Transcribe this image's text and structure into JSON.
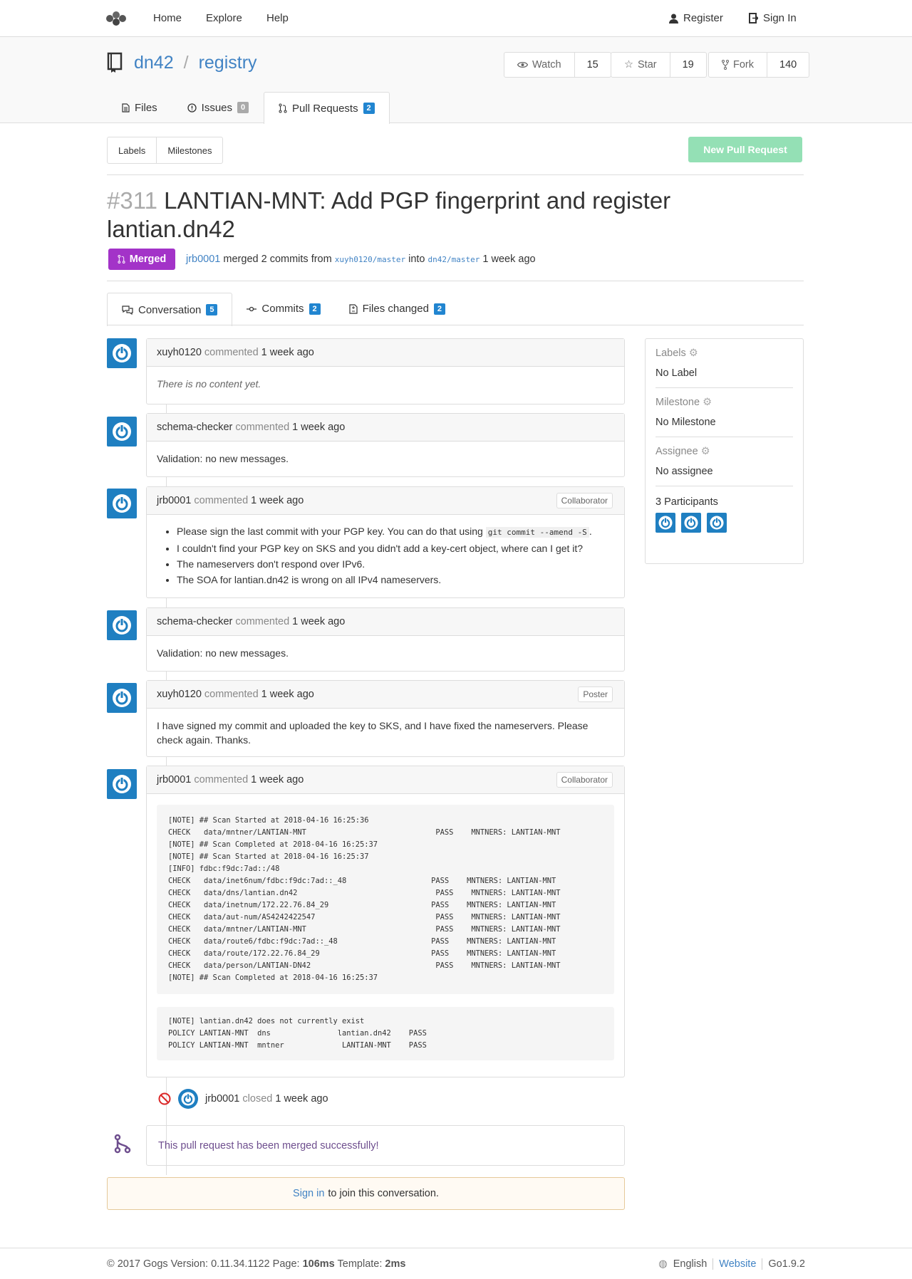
{
  "nav": {
    "home": "Home",
    "explore": "Explore",
    "help": "Help",
    "register": "Register",
    "sign_in": "Sign In"
  },
  "repo": {
    "owner": "dn42",
    "separator": "/",
    "name": "registry"
  },
  "actions": [
    {
      "label": "Watch",
      "count": "15",
      "icon": "eye-icon"
    },
    {
      "label": "Star",
      "count": "19",
      "icon": "star-icon"
    },
    {
      "label": "Fork",
      "count": "140",
      "icon": "fork-icon"
    }
  ],
  "repo_tabs": [
    {
      "label": "Files",
      "icon": "file-text-icon"
    },
    {
      "label": "Issues",
      "count": "0",
      "icon": "issue-icon"
    },
    {
      "label": "Pull Requests",
      "count": "2",
      "icon": "pull-request-icon"
    }
  ],
  "subnav": {
    "labels": "Labels",
    "milestones": "Milestones",
    "new_pr": "New Pull Request"
  },
  "pr": {
    "number": "#311",
    "title": "LANTIAN-MNT: Add PGP fingerprint and register lantian.dn42",
    "status": "Merged",
    "merger": "jrb0001",
    "merged_text": "merged 2 commits from",
    "head_branch": "xuyh0120/master",
    "into": "into",
    "base_branch": "dn42/master",
    "time": "1 week ago"
  },
  "conv_tabs": [
    {
      "label": "Conversation",
      "count": "5",
      "icon": "comments-icon"
    },
    {
      "label": "Commits",
      "count": "2",
      "icon": "commit-icon"
    },
    {
      "label": "Files changed",
      "count": "2",
      "icon": "file-diff-icon"
    }
  ],
  "comments": [
    {
      "user": "xuyh0120",
      "action": "commented",
      "time": "1 week ago",
      "role": "",
      "body": "There is no content yet."
    },
    {
      "user": "schema-checker",
      "action": "commented",
      "time": "1 week ago",
      "role": "",
      "body": "Validation: no new messages."
    },
    {
      "user": "jrb0001",
      "action": "commented",
      "time": "1 week ago",
      "role": "Collaborator",
      "items": [
        {
          "pre": "Please sign the last commit with your PGP key. You can do that using",
          "code": "git commit --amend -S",
          "post": "."
        },
        {
          "pre": "I couldn't find your PGP key on SKS and you didn't add a key-cert object, where can I get it?"
        },
        {
          "pre": "The nameservers don't respond over IPv6."
        },
        {
          "pre": "The SOA for lantian.dn42 is wrong on all IPv4 nameservers."
        }
      ]
    },
    {
      "user": "schema-checker",
      "action": "commented",
      "time": "1 week ago",
      "role": "",
      "body": "Validation: no new messages."
    },
    {
      "user": "xuyh0120",
      "action": "commented",
      "time": "1 week ago",
      "role": "Poster",
      "body": "I have signed my commit and uploaded the key to SKS, and I have fixed the nameservers. Please check again. Thanks."
    },
    {
      "user": "jrb0001",
      "action": "commented",
      "time": "1 week ago",
      "role": "Collaborator",
      "log1": "[NOTE] ## Scan Started at 2018-04-16 16:25:36\nCHECK   data/mntner/LANTIAN-MNT                             PASS    MNTNERS: LANTIAN-MNT\n[NOTE] ## Scan Completed at 2018-04-16 16:25:37\n[NOTE] ## Scan Started at 2018-04-16 16:25:37\n[INFO] fdbc:f9dc:7ad::/48\nCHECK   data/inet6num/fdbc:f9dc:7ad::_48                   PASS    MNTNERS: LANTIAN-MNT\nCHECK   data/dns/lantian.dn42                               PASS    MNTNERS: LANTIAN-MNT\nCHECK   data/inetnum/172.22.76.84_29                       PASS    MNTNERS: LANTIAN-MNT\nCHECK   data/aut-num/AS4242422547                           PASS    MNTNERS: LANTIAN-MNT\nCHECK   data/mntner/LANTIAN-MNT                             PASS    MNTNERS: LANTIAN-MNT\nCHECK   data/route6/fdbc:f9dc:7ad::_48                     PASS    MNTNERS: LANTIAN-MNT\nCHECK   data/route/172.22.76.84_29                         PASS    MNTNERS: LANTIAN-MNT\nCHECK   data/person/LANTIAN-DN42                            PASS    MNTNERS: LANTIAN-MNT\n[NOTE] ## Scan Completed at 2018-04-16 16:25:37",
      "log2": "[NOTE] lantian.dn42 does not currently exist\nPOLICY LANTIAN-MNT  dns               lantian.dn42    PASS\nPOLICY LANTIAN-MNT  mntner             LANTIAN-MNT    PASS"
    }
  ],
  "event_close": {
    "user": "jrb0001",
    "action": "closed",
    "time": "1 week ago"
  },
  "merged_message": "This pull request has been merged successfully!",
  "signin": {
    "link": "Sign in",
    "text": "to join this conversation."
  },
  "sidebar": {
    "labels_title": "Labels",
    "labels_value": "No Label",
    "milestone_title": "Milestone",
    "milestone_value": "No Milestone",
    "assignee_title": "Assignee",
    "assignee_value": "No assignee",
    "participants": "3 Participants"
  },
  "footer": {
    "copyright": "© 2017 Gogs Version: 0.11.34.1122 Page:",
    "page_time": "106ms",
    "template_label": "Template:",
    "template_time": "2ms",
    "language": "English",
    "website": "Website",
    "go_version": "Go1.9.2"
  },
  "colors": {
    "accent": "#4183c4",
    "merged": "#a333c8",
    "new_pr": "#94e0b5",
    "badge": "#2185d0",
    "avatar": "#1f7fc1"
  }
}
